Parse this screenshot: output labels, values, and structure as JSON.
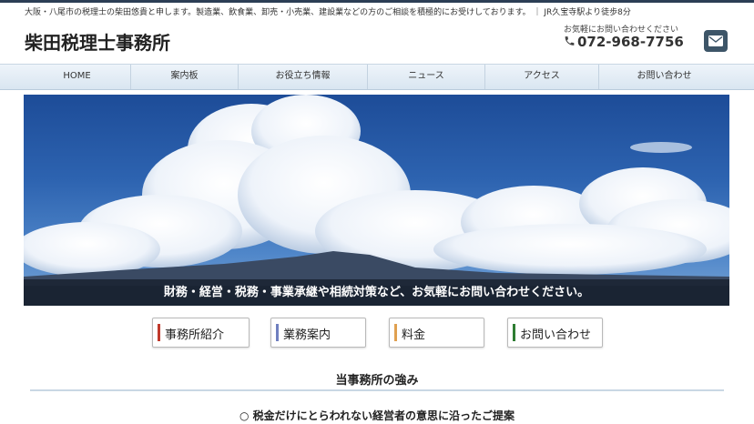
{
  "header": {
    "tagline": "大阪・八尾市の税理士の柴田悠貴と申します。製造業、飲食業、卸売・小売業、建設業などの方のご相談を積極的にお受けしております。 ｜ JR久宝寺駅より徒歩8分",
    "site_title": "柴田税理士事務所",
    "contact_note": "お気軽にお問い合わせください",
    "phone": "072-968-7756"
  },
  "nav": {
    "items": [
      {
        "label": "HOME"
      },
      {
        "label": "案内板"
      },
      {
        "label": "お役立ち情報"
      },
      {
        "label": "ニュース"
      },
      {
        "label": "アクセス"
      },
      {
        "label": "お問い合わせ"
      }
    ]
  },
  "hero": {
    "caption": "財務・経営・税務・事業承継や相続対策など、お気軽にお問い合わせください。"
  },
  "services": [
    {
      "label": "事務所紹介",
      "accent": "#c0392b"
    },
    {
      "label": "業務案内",
      "accent": "#6f7fbf"
    },
    {
      "label": "料金",
      "accent": "#e0a050"
    },
    {
      "label": "お問い合わせ",
      "accent": "#2e7d32"
    }
  ],
  "strengths": {
    "title": "当事務所の強み",
    "items": [
      "○ 税金だけにとらわれない経営者の意思に沿ったご提案"
    ]
  },
  "colors": {
    "header_bar": "#2c3e55",
    "mail_button": "#3d5568"
  },
  "icons": {
    "phone": "phone-icon",
    "mail": "mail-icon"
  }
}
